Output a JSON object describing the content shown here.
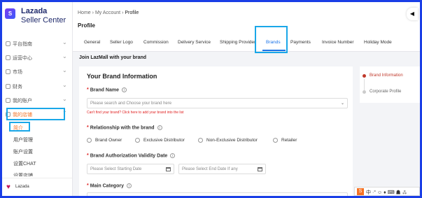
{
  "brand": {
    "logo_text_1": "Lazada",
    "logo_text_2": "Seller Center",
    "logo_mark": "S",
    "footer_brand": "Lazada"
  },
  "sidebar": {
    "items": [
      {
        "label": "平台指南",
        "chevron": "⌄"
      },
      {
        "label": "运营中心",
        "chevron": "⌄"
      },
      {
        "label": "市场",
        "chevron": "⌄"
      },
      {
        "label": "财务",
        "chevron": "⌄"
      },
      {
        "label": "我的账户",
        "chevron": "⌄"
      },
      {
        "label": "我的店铺",
        "chevron": "⌃"
      }
    ],
    "sub_items": [
      "简介",
      "用户管理",
      "账户设置",
      "设置CHAT",
      "设置店铺"
    ]
  },
  "header": {
    "breadcrumb": [
      "Home",
      "My Account",
      "Profile"
    ],
    "separator": "›",
    "page_title": "Profile",
    "collapse_icon": "◀"
  },
  "tabs": [
    "General",
    "Seller Logo",
    "Commission",
    "Delivery Service",
    "Shipping Provider",
    "Brands",
    "Payments",
    "Invoice Number",
    "Holiday Mode"
  ],
  "active_tab": "Brands",
  "join_heading": "Join LazMall with your brand",
  "form": {
    "title": "Your Brand Information",
    "brand_name_label": "Brand Name",
    "brand_placeholder": "Please search and Choose your brand here",
    "brand_error": "Can't find your brand? Click here to add your brand into the list",
    "relationship_label": "Relationship with the brand",
    "relationship_options": [
      "Brand Owner",
      "Exclusive Distributor",
      "Non-Exclusive Distributor",
      "Retailer"
    ],
    "validity_label": "Brand Authorization Validity Date",
    "start_placeholder": "Please Select Starting Date",
    "end_placeholder": "Please Select End Date If any",
    "main_category_label": "Main Category",
    "required_mark": "*",
    "info_glyph": "i",
    "dropdown_caret": "⌄"
  },
  "steps": [
    {
      "label": "Brand Information",
      "active": true
    },
    {
      "label": "Corporate Profile",
      "active": false
    }
  ],
  "ime_bar": {
    "logo": "S",
    "text": "中 ·° ☺ ♦ ⌨ ☗ ⁂"
  },
  "colors": {
    "accent_blue": "#1a73e8",
    "highlight_box": "#1aa7e8",
    "error_red": "#e02020",
    "step_active": "#c0392b",
    "frame_blue": "#1a3ee6"
  }
}
